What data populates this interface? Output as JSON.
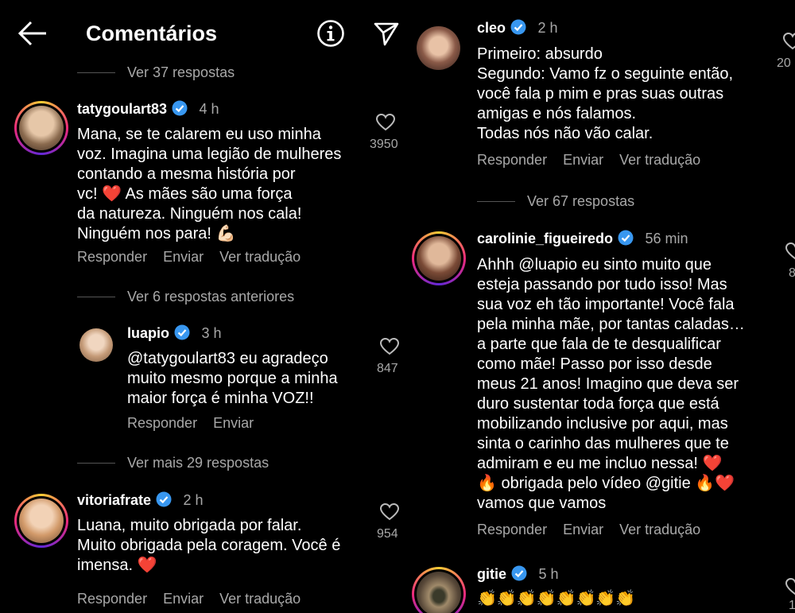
{
  "header": {
    "title": "Comentários"
  },
  "left": {
    "replies_top": "Ver 37 respostas",
    "comment1": {
      "user": "tatygoulart83",
      "time": "4 h",
      "lines": [
        "Mana, se te calarem eu uso minha",
        "voz. Imagina uma legião de mulheres",
        "contando a mesma história por",
        "vc! ❤️ As mães são uma força",
        "da natureza. Ninguém nos cala!",
        "Ninguém nos para! 💪🏻"
      ],
      "likes": "3950",
      "actions": [
        "Responder",
        "Enviar",
        "Ver tradução"
      ]
    },
    "replies_prev": "Ver 6 respostas anteriores",
    "reply1": {
      "user": "luapio",
      "time": "3 h",
      "lines": [
        "@tatygoulart83 eu agradeço",
        "muito mesmo porque a minha",
        "maior força é minha VOZ!!"
      ],
      "likes": "847",
      "actions": [
        "Responder",
        "Enviar"
      ]
    },
    "replies_more": "Ver mais 29 respostas",
    "comment2": {
      "user": "vitoriafrate",
      "time": "2 h",
      "lines": [
        "Luana, muito obrigada por falar.",
        "Muito obrigada pela coragem. Você é",
        "imensa. ❤️"
      ],
      "likes": "954",
      "actions": [
        "Responder",
        "Enviar",
        "Ver tradução"
      ]
    }
  },
  "right": {
    "comment1": {
      "user": "cleo",
      "time": "2 h",
      "lines": [
        "Primeiro: absurdo",
        "Segundo: Vamo fz o seguinte então,",
        "você fala p mim e pras suas outras",
        "amigas e nós falamos.",
        "Todas nós não vão calar."
      ],
      "likes": "20",
      "actions": [
        "Responder",
        "Enviar",
        "Ver tradução"
      ]
    },
    "replies": "Ver 67 respostas",
    "comment2": {
      "user": "carolinie_figueiredo",
      "time": "56 min",
      "lines": [
        "Ahhh  @luapio eu sinto muito que",
        "esteja passando por tudo isso! Mas",
        "sua voz eh tão importante! Você fala",
        "pela minha mãe, por tantas caladas…",
        "a parte que fala de te desqualificar",
        "como mãe! Passo por isso desde",
        "meus 21 anos! Imagino que deva ser",
        "duro sustentar toda força que está",
        "mobilizando inclusive por aqui, mas",
        "sinta o carinho das mulheres que te",
        "admiram e eu me incluo nessa! ❤️",
        "🔥 obrigada pelo vídeo @gitie 🔥❤️",
        "vamos que vamos"
      ],
      "likes": "8",
      "actions": [
        "Responder",
        "Enviar",
        "Ver tradução"
      ]
    },
    "comment3": {
      "user": "gitie",
      "time": "5 h",
      "text": "👏👏👏👏👏👏👏👏",
      "likes": "1"
    }
  },
  "colors": {
    "background": "#000000",
    "verified": "#3897f0",
    "heart_red": "#e0245e"
  }
}
